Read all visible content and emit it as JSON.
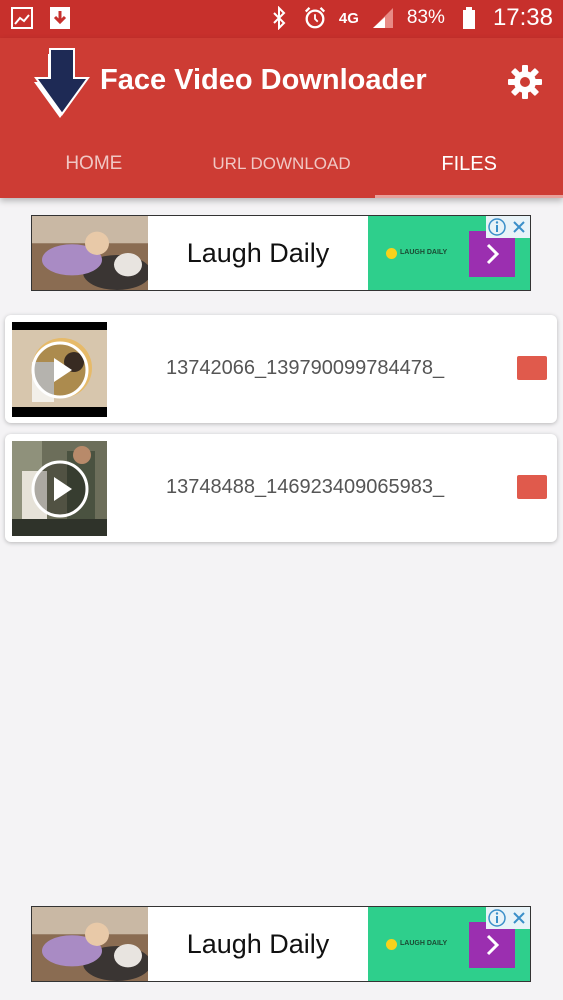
{
  "status_bar": {
    "network": "4G",
    "battery": "83%",
    "time": "17:38",
    "icons": [
      "gallery-icon",
      "download-icon",
      "bluetooth-icon",
      "alarm-icon",
      "signal-icon",
      "battery-icon"
    ]
  },
  "app": {
    "title": "Face Video Downloader",
    "logo_icon": "download-arrow-icon",
    "settings_icon": "gear-icon"
  },
  "tabs": [
    {
      "label": "HOME",
      "active": false
    },
    {
      "label": "URL DOWNLOAD",
      "active": false
    },
    {
      "label": "FILES",
      "active": true
    }
  ],
  "ads": [
    {
      "text": "Laugh Daily",
      "brand": "LAUGH DAILY"
    },
    {
      "text": "Laugh Daily",
      "brand": "LAUGH DAILY"
    }
  ],
  "files": [
    {
      "name": "13742066_139790099784478_"
    },
    {
      "name": "13748488_146923409065983_"
    }
  ],
  "colors": {
    "status_bar": "#c7302c",
    "app_bar": "#cd3c34",
    "delete_button": "#e05a4c",
    "ad_green": "#2ecf8c",
    "ad_arrow": "#9b2fb0"
  }
}
